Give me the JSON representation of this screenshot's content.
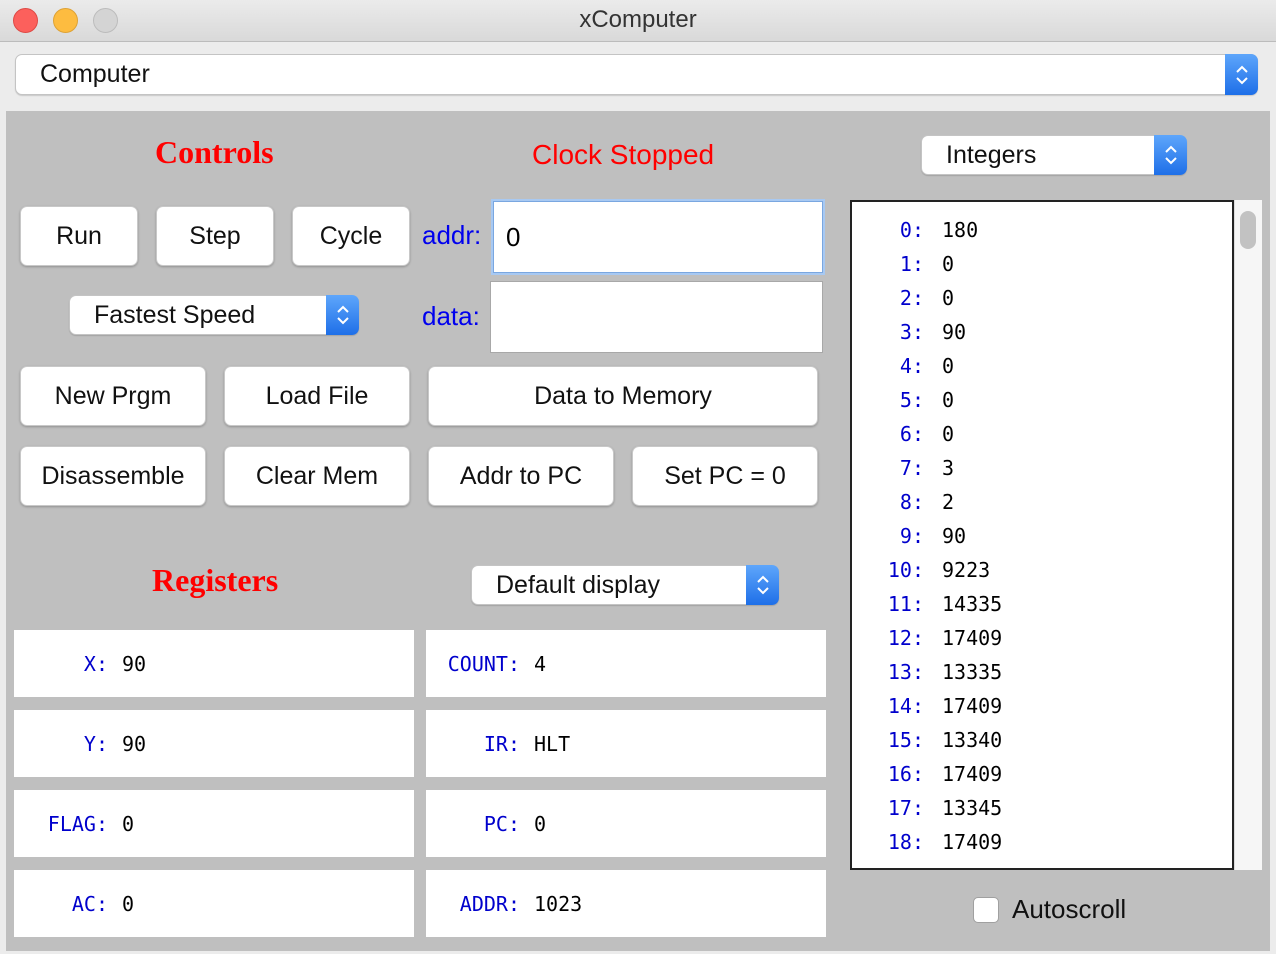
{
  "window": {
    "title": "xComputer"
  },
  "mode_select": {
    "value": "Computer"
  },
  "controls": {
    "heading": "Controls",
    "clock_status": "Clock Stopped",
    "run_label": "Run",
    "step_label": "Step",
    "cycle_label": "Cycle",
    "speed_select": "Fastest Speed",
    "addr_label": "addr:",
    "addr_value": "0",
    "data_label": "data:",
    "data_value": "",
    "new_prgm_label": "New Prgm",
    "load_file_label": "Load File",
    "data_to_memory_label": "Data to Memory",
    "disassemble_label": "Disassemble",
    "clear_mem_label": "Clear Mem",
    "addr_to_pc_label": "Addr to PC",
    "set_pc_label": "Set PC = 0"
  },
  "registers": {
    "heading": "Registers",
    "display_select": "Default display",
    "left": [
      {
        "name": "X:",
        "value": "90"
      },
      {
        "name": "Y:",
        "value": "90"
      },
      {
        "name": "FLAG:",
        "value": "0"
      },
      {
        "name": "AC:",
        "value": "0"
      }
    ],
    "right": [
      {
        "name": "COUNT:",
        "value": "4"
      },
      {
        "name": "IR:",
        "value": "HLT"
      },
      {
        "name": "PC:",
        "value": "0"
      },
      {
        "name": "ADDR:",
        "value": "1023"
      }
    ]
  },
  "memory": {
    "format_select": "Integers",
    "rows": [
      {
        "addr": "0:",
        "value": "180"
      },
      {
        "addr": "1:",
        "value": "0"
      },
      {
        "addr": "2:",
        "value": "0"
      },
      {
        "addr": "3:",
        "value": "90"
      },
      {
        "addr": "4:",
        "value": "0"
      },
      {
        "addr": "5:",
        "value": "0"
      },
      {
        "addr": "6:",
        "value": "0"
      },
      {
        "addr": "7:",
        "value": "3"
      },
      {
        "addr": "8:",
        "value": "2"
      },
      {
        "addr": "9:",
        "value": "90"
      },
      {
        "addr": "10:",
        "value": "9223"
      },
      {
        "addr": "11:",
        "value": "14335"
      },
      {
        "addr": "12:",
        "value": "17409"
      },
      {
        "addr": "13:",
        "value": "13335"
      },
      {
        "addr": "14:",
        "value": "17409"
      },
      {
        "addr": "15:",
        "value": "13340"
      },
      {
        "addr": "16:",
        "value": "17409"
      },
      {
        "addr": "17:",
        "value": "13345"
      },
      {
        "addr": "18:",
        "value": "17409"
      }
    ],
    "autoscroll_label": "Autoscroll",
    "autoscroll_checked": false
  },
  "colors": {
    "heading": "#ff0000",
    "register_name": "#0000cc",
    "accent": "#1e6fe8"
  }
}
